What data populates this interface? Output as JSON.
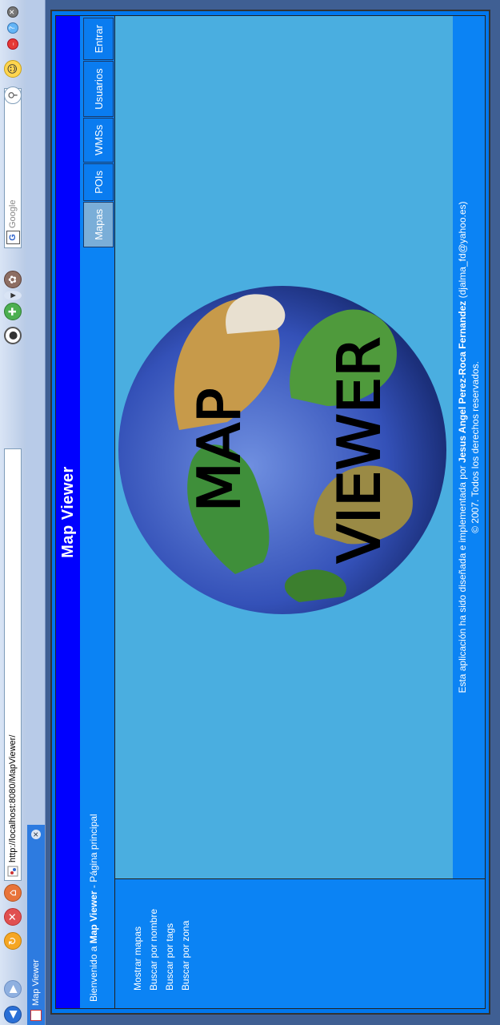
{
  "browser": {
    "url": "http://localhost:8080/MapViewer/",
    "search_placeholder": "Google",
    "tab_title": "Map Viewer"
  },
  "header": {
    "title": "Map Viewer"
  },
  "welcome": {
    "prefix": "Bienvenido a ",
    "app": "Map Viewer",
    "suffix": " - Página principal"
  },
  "nav": {
    "items": [
      "Mapas",
      "POIs",
      "WMSs",
      "Usuarios",
      "Entrar"
    ],
    "active": "Mapas"
  },
  "sidebar": {
    "items": [
      "Mostrar mapas",
      "Buscar por nombre",
      "Buscar por tags",
      "Buscar por zona"
    ]
  },
  "logo": {
    "line1": "MAP",
    "line2": "VIEWER"
  },
  "footer": {
    "line1_prefix": "Esta aplicación ha sido diseñada e implementada por ",
    "author": "Jesus Angel Perez-Roca Fernandez",
    "email": " (djalma_fd@yahoo.es)",
    "line2": "© 2007. Todos los derechos reservados."
  },
  "colors": {
    "header": "#0000ff",
    "frame": "#0b83f4",
    "content": "#4aaee0"
  }
}
